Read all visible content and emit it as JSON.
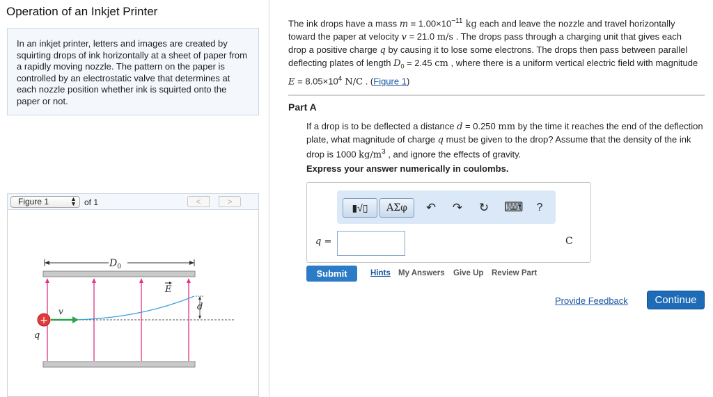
{
  "left": {
    "title": "Operation of an Inkjet Printer",
    "intro": "In an inkjet printer, letters and images are created by squirting drops of ink horizontally at a sheet of paper from a rapidly moving nozzle. The pattern on the paper is controlled by an electrostatic valve that determines at each nozzle position whether ink is squirted onto the paper or not.",
    "figure_bar": {
      "selected": "Figure 1",
      "of_label": "of 1",
      "prev": "<",
      "next": ">"
    },
    "figure": {
      "length_label": "D",
      "length_sub": "0",
      "field_label": "E",
      "deflection_label": "d",
      "velocity_label": "v",
      "charge_label": "q",
      "plus_sign": "+"
    }
  },
  "problem": {
    "p1": "The ink drops have a mass ",
    "m_sym": "m",
    "p2": " = 1.00×10",
    "m_exp": "−11",
    "m_unit": " kg",
    "p3": " each and leave the nozzle and travel horizontally toward the paper at velocity ",
    "v_sym": "v",
    "p4": " = 21.0 ",
    "v_unit": "m/s",
    "p5": " . The drops pass through a charging unit that gives each drop a positive charge ",
    "q_sym": "q",
    "p6": " by causing it to lose some electrons. The drops then pass between parallel deflecting plates of length ",
    "d0_sym": "D",
    "d0_sub": "0",
    "p7": " = 2.45 ",
    "d0_unit": "cm",
    "p8": " , where there is a uniform vertical electric field with magnitude ",
    "e_sym": "E",
    "p9": " = 8.05×10",
    "e_exp": "4",
    "e_unit": " N/C",
    "p10": " . (",
    "figure_link": "Figure 1",
    "p11": ")"
  },
  "part": {
    "title": "Part A",
    "q1": "If a drop is to be deflected a distance ",
    "d_sym": "d",
    "q2": " = 0.250 ",
    "d_unit": "mm",
    "q3": " by the time it reaches the end of the deflection plate, what magnitude of charge ",
    "q_sym": "q",
    "q4": " must be given to the drop? Assume that the density of the ink drop is 1000 ",
    "rho_unit": "kg/m",
    "rho_exp": "3",
    "q5": " , and ignore the effects of gravity.",
    "instruction": "Express your answer numerically in coulombs."
  },
  "answer": {
    "toolbar": {
      "template_label": "▮√▯",
      "symbols_label": "ΑΣφ",
      "undo": "↶",
      "redo": "↷",
      "reset": "↻",
      "keyboard": "⌨",
      "help": "?"
    },
    "var_label": "q =",
    "value": "",
    "units": "C"
  },
  "actions": {
    "submit": "Submit",
    "hints": "Hints",
    "my_answers": "My Answers",
    "give_up": "Give Up",
    "review_part": "Review Part"
  },
  "footer": {
    "feedback": "Provide Feedback",
    "continue": "Continue"
  },
  "colors": {
    "accent": "#2b7bc6",
    "link": "#1a56a6",
    "field_lines": "#e0338a",
    "trajectory": "#3aa2dc",
    "velocity_arrow": "#2aa34a",
    "charge_fill": "#e33b3b"
  }
}
